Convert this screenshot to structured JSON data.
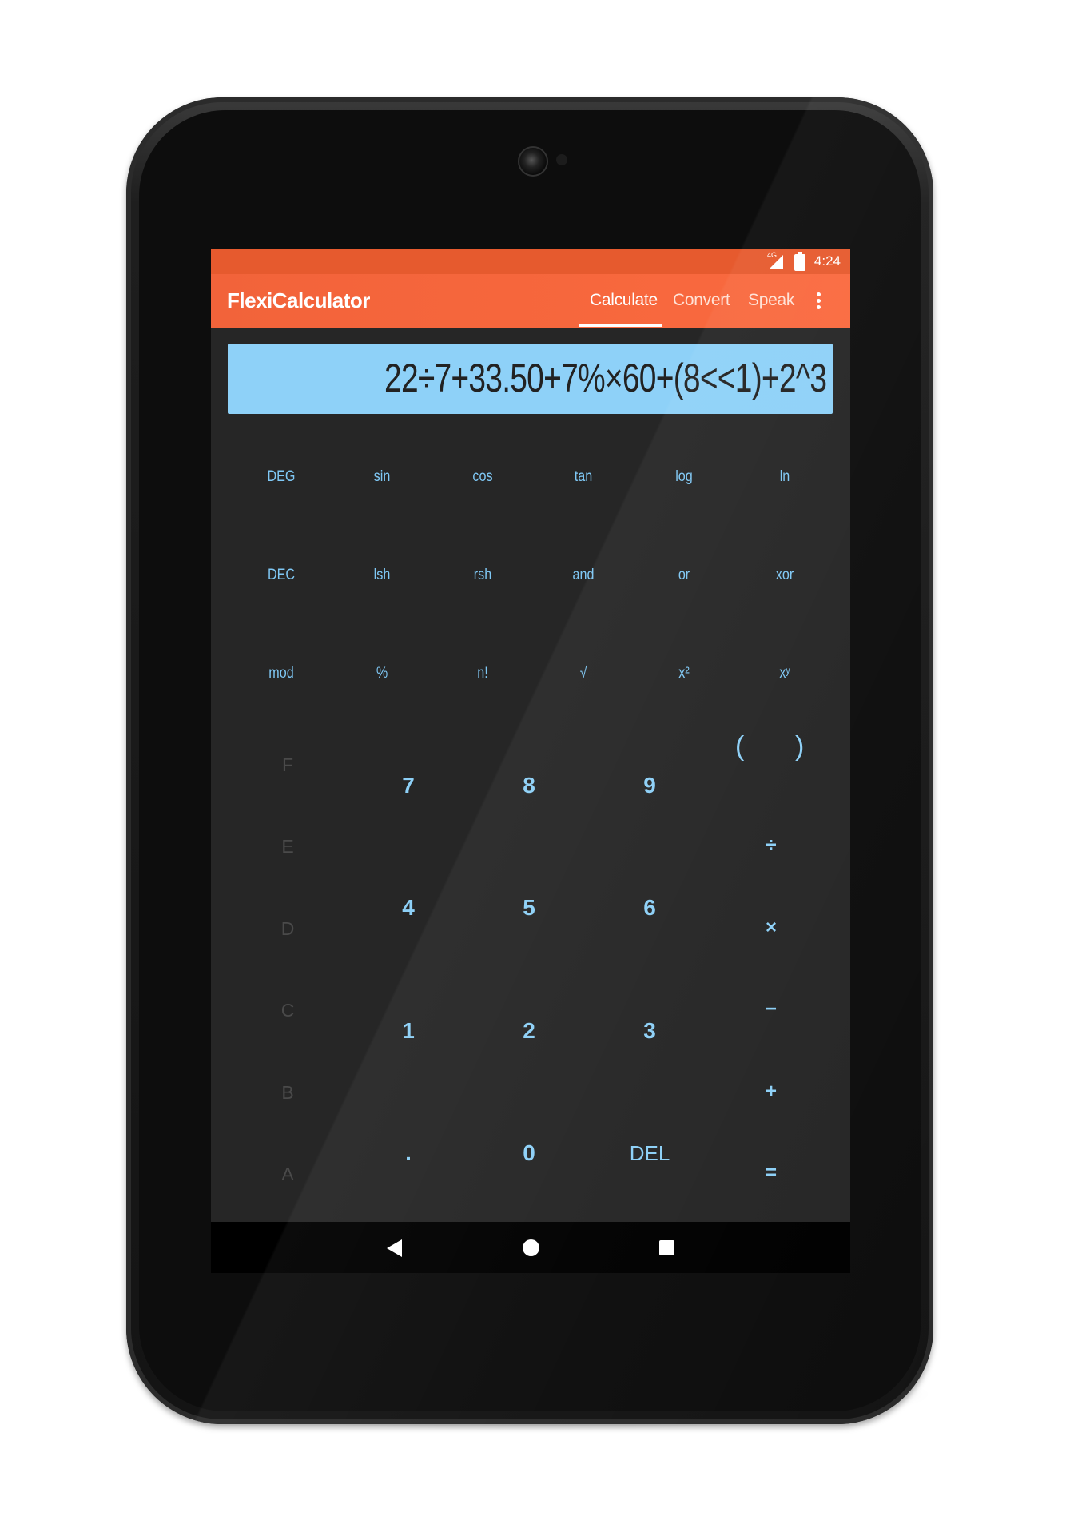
{
  "status_bar": {
    "network": "4G",
    "time": "4:24"
  },
  "app_bar": {
    "title": "FlexiCalculator",
    "tabs": [
      {
        "label": "Calculate",
        "active": true
      },
      {
        "label": "Convert",
        "active": false
      },
      {
        "label": "Speak",
        "active": false
      }
    ],
    "overflow_icon": "more-vert-icon"
  },
  "display": {
    "expression": "22÷7+33.50+7%×60+(8<<1)+2^3"
  },
  "scientific_keys": {
    "row1": [
      "DEG",
      "sin",
      "cos",
      "tan",
      "log",
      "ln"
    ],
    "row2": [
      "DEC",
      "lsh",
      "rsh",
      "and",
      "or",
      "xor"
    ],
    "row3": [
      "mod",
      "%",
      "n!",
      "√",
      "x²",
      "xʸ"
    ]
  },
  "hex_keys": [
    "F",
    "E",
    "D",
    "C",
    "B",
    "A"
  ],
  "number_keys": {
    "row1": [
      "7",
      "8",
      "9"
    ],
    "row2": [
      "4",
      "5",
      "6"
    ],
    "row3": [
      "1",
      "2",
      "3"
    ],
    "row4": [
      ".",
      "0",
      "DEL"
    ]
  },
  "operator_keys": {
    "paren_open": "(",
    "paren_close": ")",
    "divide": "÷",
    "multiply": "×",
    "subtract": "−",
    "add": "+",
    "equals": "="
  },
  "colors": {
    "app_bar": "#fa6a3f",
    "status_bar": "#e65a2e",
    "display_bg": "#8ed1f8",
    "key_text": "#8dd0f7",
    "hex_key_text": "#4a4a4a",
    "keypad_bg": "#262626"
  },
  "nav_bar": {
    "back_icon": "back-triangle-icon",
    "home_icon": "home-circle-icon",
    "recents_icon": "recents-square-icon"
  }
}
